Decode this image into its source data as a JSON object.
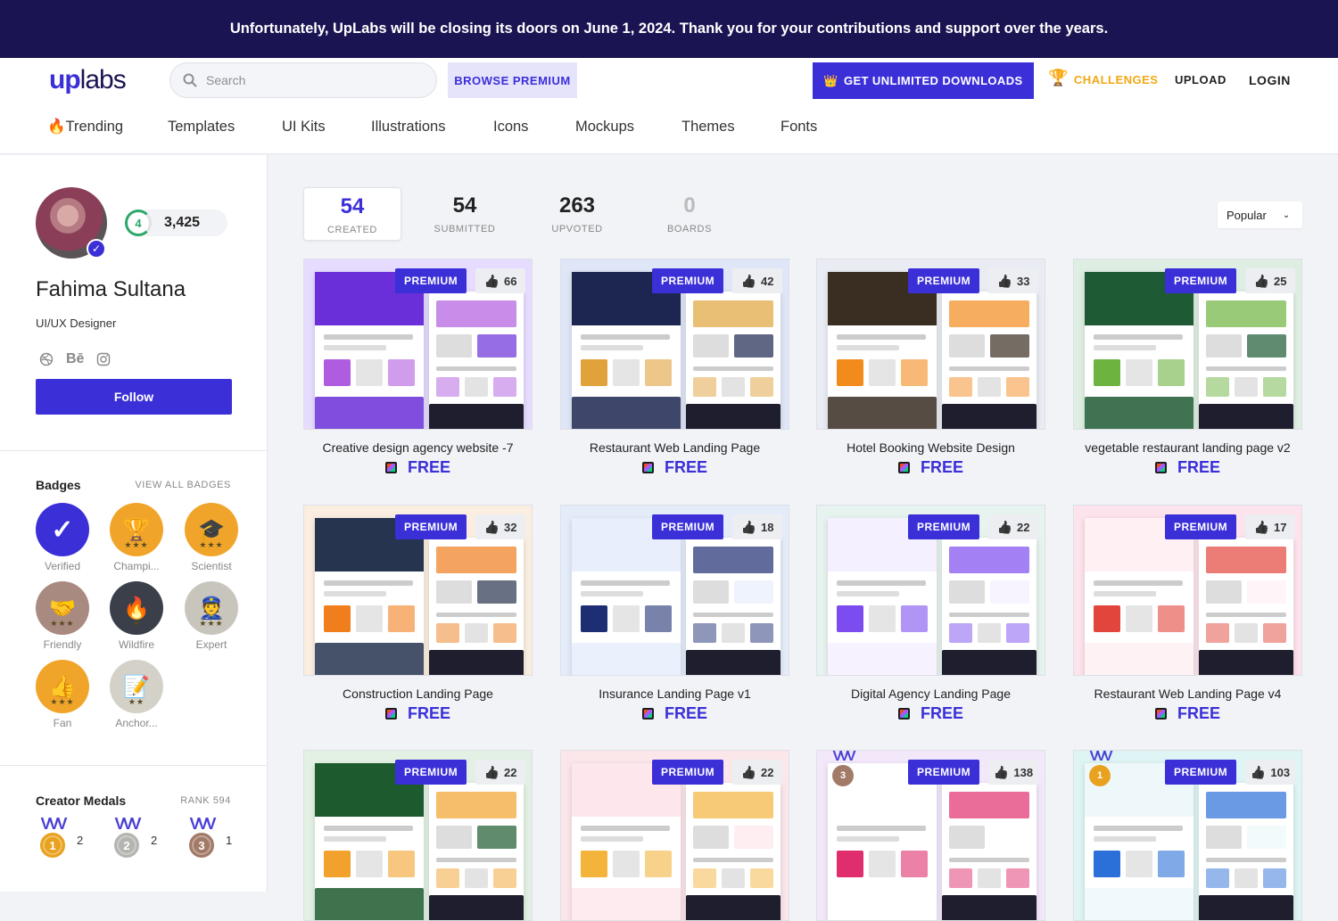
{
  "banner": {
    "text": "Unfortunately, UpLabs will be closing its doors on June 1, 2024. Thank you for your contributions and support over the years."
  },
  "header": {
    "logo_up": "up",
    "logo_labs": "labs",
    "search_placeholder": "Search",
    "browse_premium": "BROWSE PREMIUM",
    "get_unlimited": "GET UNLIMITED DOWNLOADS",
    "challenges": "CHALLENGES",
    "upload": "UPLOAD",
    "login": "LOGIN"
  },
  "nav": [
    "🔥Trending",
    "Templates",
    "UI Kits",
    "Illustrations",
    "Icons",
    "Mockups",
    "Themes",
    "Fonts"
  ],
  "profile": {
    "level": "4",
    "points": "3,425",
    "name": "Fahima Sultana",
    "role": "UI/UX Designer",
    "follow": "Follow",
    "socials": [
      "dribbble-icon",
      "behance-icon",
      "instagram-icon"
    ]
  },
  "badges": {
    "title": "Badges",
    "view_all": "VIEW ALL BADGES",
    "items": [
      {
        "label": "Verified",
        "icon": "✓",
        "stars": "",
        "color": "#3b2fd8"
      },
      {
        "label": "Champi...",
        "icon": "🏆",
        "stars": "★★★",
        "color": "#f0a52a"
      },
      {
        "label": "Scientist",
        "icon": "🎓",
        "stars": "★★★",
        "color": "#f0a52a"
      },
      {
        "label": "Friendly",
        "icon": "🤝",
        "stars": "★★★",
        "color": "#a98a80"
      },
      {
        "label": "Wildfire",
        "icon": "🔥",
        "stars": "★",
        "color": "#3a3f4a"
      },
      {
        "label": "Expert",
        "icon": "👮",
        "stars": "★★★",
        "color": "#c8c6bc"
      },
      {
        "label": "Fan",
        "icon": "👍",
        "stars": "★★★",
        "color": "#f0a52a"
      },
      {
        "label": "Anchor...",
        "icon": "📝",
        "stars": "★★",
        "color": "#d3d1c8"
      }
    ]
  },
  "medals": {
    "title": "Creator Medals",
    "rank": "RANK 594",
    "items": [
      {
        "place": "1",
        "count": "2",
        "color": "#e8a21f"
      },
      {
        "place": "2",
        "count": "2",
        "color": "#b4b4b0"
      },
      {
        "place": "3",
        "count": "1",
        "color": "#a27a68"
      }
    ]
  },
  "stats": [
    {
      "num": "54",
      "label": "CREATED"
    },
    {
      "num": "54",
      "label": "SUBMITTED"
    },
    {
      "num": "263",
      "label": "UPVOTED"
    },
    {
      "num": "0",
      "label": "BOARDS"
    }
  ],
  "sort": {
    "value": "Popular"
  },
  "cards": [
    {
      "title": "Creative design agency website -7",
      "likes": "66",
      "premium": "PREMIUM",
      "price": "FREE",
      "bg": "#e6dcff",
      "hero": "#6a2fd8",
      "accent": "#b05ce0",
      "medal": ""
    },
    {
      "title": "Restaurant Web Landing Page",
      "likes": "42",
      "premium": "PREMIUM",
      "price": "FREE",
      "bg": "#dfe6f7",
      "hero": "#1c2650",
      "accent": "#e0a23a",
      "medal": ""
    },
    {
      "title": "Hotel Booking Website Design",
      "likes": "33",
      "premium": "PREMIUM",
      "price": "FREE",
      "bg": "#e9edf3",
      "hero": "#3a2d22",
      "accent": "#f38a1c",
      "medal": ""
    },
    {
      "title": "vegetable restaurant landing page v2",
      "likes": "25",
      "premium": "PREMIUM",
      "price": "FREE",
      "bg": "#dfeee3",
      "hero": "#1e5a33",
      "accent": "#6db33f",
      "medal": ""
    },
    {
      "title": "Construction Landing Page",
      "likes": "32",
      "premium": "PREMIUM",
      "price": "FREE",
      "bg": "#fbeee0",
      "hero": "#26344f",
      "accent": "#f07e1c",
      "medal": ""
    },
    {
      "title": "Insurance Landing Page v1",
      "likes": "18",
      "premium": "PREMIUM",
      "price": "FREE",
      "bg": "#e4ecfa",
      "hero": "#e8eefc",
      "accent": "#1e2e73",
      "medal": ""
    },
    {
      "title": "Digital Agency Landing Page",
      "likes": "22",
      "premium": "PREMIUM",
      "price": "FREE",
      "bg": "#e7f3ee",
      "hero": "#f4f0ff",
      "accent": "#7c4cf0",
      "medal": ""
    },
    {
      "title": "Restaurant Web Landing Page v4",
      "likes": "17",
      "premium": "PREMIUM",
      "price": "FREE",
      "bg": "#fde3ec",
      "hero": "#fff0f3",
      "accent": "#e2453c",
      "medal": ""
    },
    {
      "title": "",
      "likes": "22",
      "premium": "PREMIUM",
      "price": "",
      "bg": "#e3f1e4",
      "hero": "#1d5a2e",
      "accent": "#f2a12c",
      "medal": ""
    },
    {
      "title": "",
      "likes": "22",
      "premium": "PREMIUM",
      "price": "",
      "bg": "#fbe6ea",
      "hero": "#fde7ec",
      "accent": "#f4b43c",
      "medal": ""
    },
    {
      "title": "",
      "likes": "138",
      "premium": "PREMIUM",
      "price": "",
      "bg": "#f2e8fa",
      "hero": "#ffffff",
      "accent": "#e02d6e",
      "medal": "3"
    },
    {
      "title": "",
      "likes": "103",
      "premium": "PREMIUM",
      "price": "",
      "bg": "#dff4f4",
      "hero": "#eef8fb",
      "accent": "#2b6fd8",
      "medal": "1"
    }
  ],
  "colors": {
    "brand": "#3b2fd8",
    "banner": "#1b1452",
    "challenge": "#f2a814"
  }
}
